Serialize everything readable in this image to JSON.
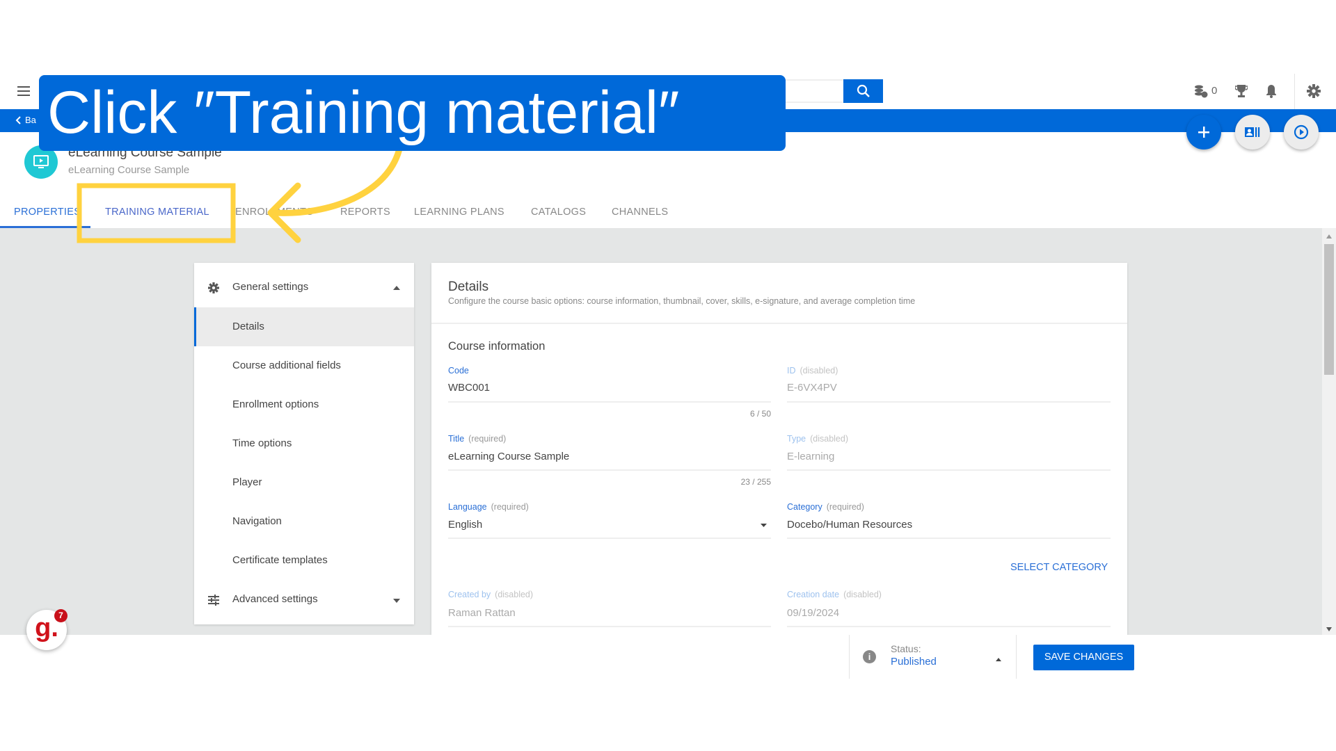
{
  "annotation": {
    "instruction": "Click ″Training material″",
    "accent": "#0069d9",
    "highlight": "#ffd23f"
  },
  "topbar": {
    "coins_count": "0",
    "icons": [
      "menu-icon",
      "search-icon",
      "coins-icon",
      "trophy-icon",
      "bell-icon",
      "gear-icon"
    ]
  },
  "backbar": {
    "back_label": "Ba"
  },
  "course": {
    "title": "eLearning Course Sample",
    "subtitle": "eLearning Course Sample",
    "icon": "play-screen-icon"
  },
  "tabs": [
    {
      "label": "PROPERTIES",
      "active": true
    },
    {
      "label": "TRAINING MATERIAL"
    },
    {
      "label": "ENROLLMENTS"
    },
    {
      "label": "REPORTS"
    },
    {
      "label": "LEARNING PLANS"
    },
    {
      "label": "CATALOGS"
    },
    {
      "label": "CHANNELS"
    }
  ],
  "sidebar": {
    "general": "General settings",
    "items": [
      "Details",
      "Course additional fields",
      "Enrollment options",
      "Time options",
      "Player",
      "Navigation",
      "Certificate templates"
    ],
    "selected": "Details",
    "advanced": "Advanced settings"
  },
  "details": {
    "title": "Details",
    "description": "Configure the course basic options: course information, thumbnail, cover, skills, e-signature, and average completion time",
    "section": "Course information",
    "code": {
      "label": "Code",
      "value": "WBC001",
      "counter": "6 / 50"
    },
    "id": {
      "label": "ID",
      "note": "(disabled)",
      "value": "E-6VX4PV"
    },
    "title_field": {
      "label": "Title",
      "note": "(required)",
      "value": "eLearning Course Sample",
      "counter": "23 / 255"
    },
    "type": {
      "label": "Type",
      "note": "(disabled)",
      "value": "E-learning"
    },
    "language": {
      "label": "Language",
      "note": "(required)",
      "value": "English"
    },
    "category": {
      "label": "Category",
      "note": "(required)",
      "value": "Docebo/Human Resources"
    },
    "select_category": "SELECT CATEGORY",
    "created_by": {
      "label": "Created by",
      "note": "(disabled)",
      "value": "Raman Rattan"
    },
    "creation_date": {
      "label": "Creation date",
      "note": "(disabled)",
      "value": "09/19/2024"
    }
  },
  "footer": {
    "status_label": "Status:",
    "status_value": "Published",
    "save": "SAVE CHANGES"
  },
  "widget": {
    "letter": "g.",
    "badge": "7"
  }
}
